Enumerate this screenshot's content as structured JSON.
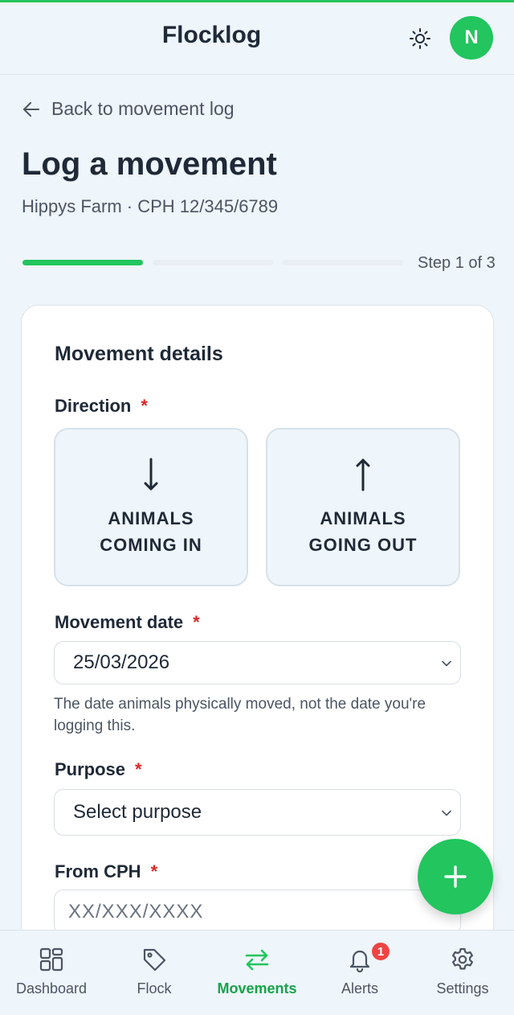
{
  "app": {
    "title": "Flocklog",
    "avatar_initial": "N"
  },
  "nav_back": {
    "label": "Back to movement log"
  },
  "page": {
    "title": "Log a movement",
    "subtitle": "Hippys Farm · CPH 12/345/6789",
    "step_label": "Step 1 of 3",
    "progress": {
      "current_step": 1,
      "total_steps": 3
    }
  },
  "form": {
    "section_title": "Movement details",
    "direction": {
      "label": "Direction",
      "required_mark": "*",
      "options": [
        {
          "label": "ANIMALS\nCOMING IN",
          "icon": "arrow-down-icon"
        },
        {
          "label": "ANIMALS\nGOING OUT",
          "icon": "arrow-up-icon"
        }
      ]
    },
    "movement_date": {
      "label": "Movement date",
      "required_mark": "*",
      "value": "25/03/2026",
      "help": "The date animals physically moved, not the date you're logging this."
    },
    "purpose": {
      "label": "Purpose",
      "required_mark": "*",
      "value": "Select purpose"
    },
    "from_cph": {
      "label": "From CPH",
      "required_mark": "*",
      "placeholder": "XX/XXX/XXXX"
    }
  },
  "bottom_nav": {
    "items": [
      {
        "label": "Dashboard",
        "icon": "grid-icon"
      },
      {
        "label": "Flock",
        "icon": "tag-icon"
      },
      {
        "label": "Movements",
        "icon": "swap-arrows-icon",
        "active": true
      },
      {
        "label": "Alerts",
        "icon": "bell-icon",
        "badge": "1"
      },
      {
        "label": "Settings",
        "icon": "gear-icon"
      }
    ]
  },
  "colors": {
    "accent": "#22c55e",
    "required": "#dc2626",
    "badge": "#ef4444",
    "background": "#eef5fb"
  }
}
